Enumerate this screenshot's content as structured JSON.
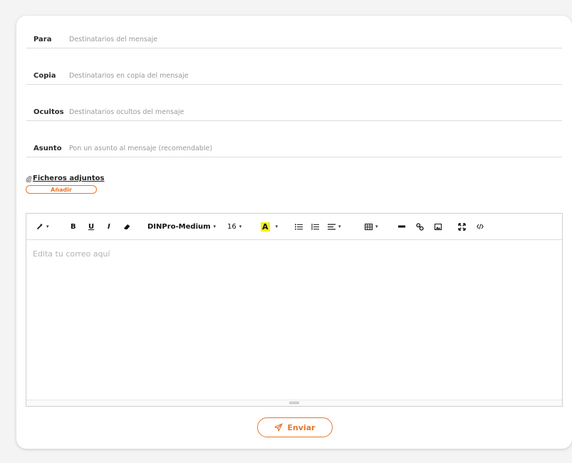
{
  "fields": [
    {
      "label": "Para",
      "placeholder": "Destinatarios del mensaje"
    },
    {
      "label": "Copia",
      "placeholder": "Destinatarios en copia del mensaje"
    },
    {
      "label": "Ocultos",
      "placeholder": "Destinatarios ocultos del mensaje"
    },
    {
      "label": "Asunto",
      "placeholder": "Pon un asunto al mensaje (recomendable)"
    }
  ],
  "attachments": {
    "title": "Ficheros adjuntos",
    "add_label": "Añadir"
  },
  "toolbar": {
    "font_name": "DINPro-Medium",
    "font_size": "16",
    "bold": "B",
    "underline": "U",
    "italic": "I",
    "highlight": "A"
  },
  "editor": {
    "placeholder": "Edita tu correo aquí"
  },
  "send_label": "Enviar",
  "colors": {
    "accent": "#e8762b",
    "highlight": "#f4ef1a"
  }
}
